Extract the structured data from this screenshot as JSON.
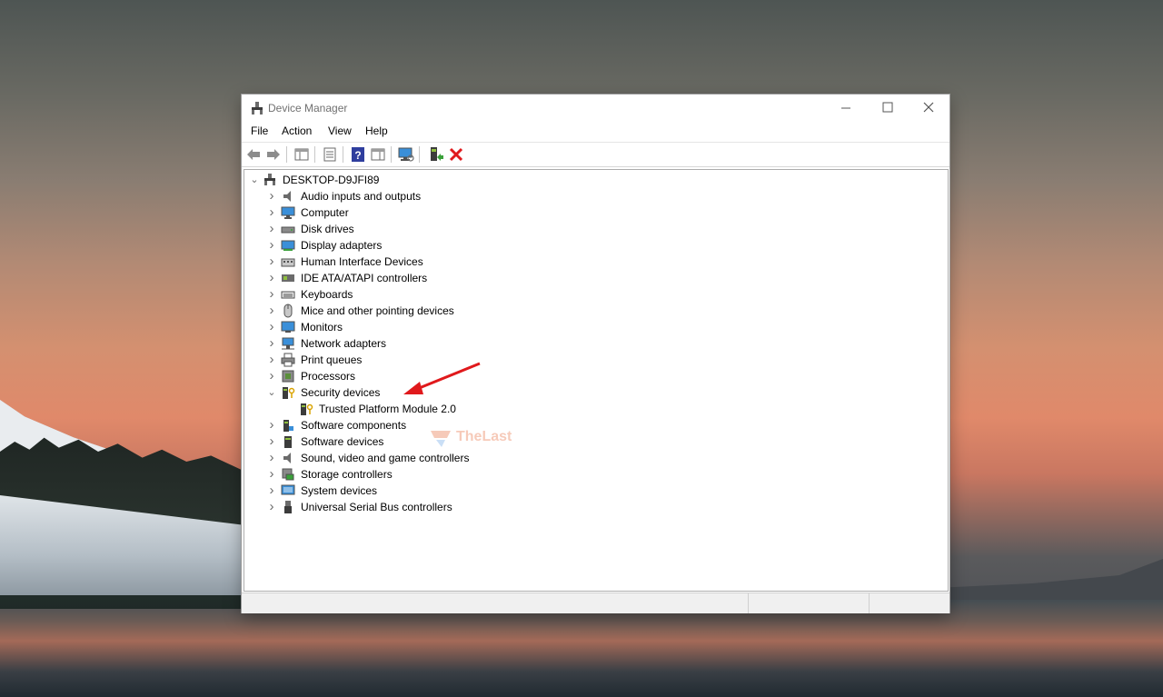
{
  "window": {
    "title": "Device Manager"
  },
  "menu": [
    "File",
    "Action",
    "View",
    "Help"
  ],
  "tree": {
    "root": "DESKTOP-D9JFI89",
    "items": [
      {
        "label": "Audio inputs and outputs",
        "icon": "speaker-icon",
        "expanded": false
      },
      {
        "label": "Computer",
        "icon": "computer-icon",
        "expanded": false
      },
      {
        "label": "Disk drives",
        "icon": "disk-drive-icon",
        "expanded": false
      },
      {
        "label": "Display adapters",
        "icon": "display-adapter-icon",
        "expanded": false
      },
      {
        "label": "Human Interface Devices",
        "icon": "hid-icon",
        "expanded": false
      },
      {
        "label": "IDE ATA/ATAPI controllers",
        "icon": "ide-controller-icon",
        "expanded": false
      },
      {
        "label": "Keyboards",
        "icon": "keyboard-icon",
        "expanded": false
      },
      {
        "label": "Mice and other pointing devices",
        "icon": "mouse-icon",
        "expanded": false
      },
      {
        "label": "Monitors",
        "icon": "monitor-icon",
        "expanded": false
      },
      {
        "label": "Network adapters",
        "icon": "network-adapter-icon",
        "expanded": false
      },
      {
        "label": "Print queues",
        "icon": "printer-icon",
        "expanded": false
      },
      {
        "label": "Processors",
        "icon": "processor-icon",
        "expanded": false
      },
      {
        "label": "Security devices",
        "icon": "security-device-icon",
        "expanded": true
      },
      {
        "label": "Trusted Platform Module 2.0",
        "icon": "tpm-icon",
        "child": true
      },
      {
        "label": "Software components",
        "icon": "software-component-icon",
        "expanded": false
      },
      {
        "label": "Software devices",
        "icon": "software-device-icon",
        "expanded": false
      },
      {
        "label": "Sound, video and game controllers",
        "icon": "sound-controller-icon",
        "expanded": false
      },
      {
        "label": "Storage controllers",
        "icon": "storage-controller-icon",
        "expanded": false
      },
      {
        "label": "System devices",
        "icon": "system-device-icon",
        "expanded": false
      },
      {
        "label": "Universal Serial Bus controllers",
        "icon": "usb-icon",
        "expanded": false
      }
    ]
  },
  "toolbar": [
    "back-arrow-icon",
    "forward-arrow-icon",
    "show-hide-tree-icon",
    "properties-icon",
    "help-icon",
    "action-pane-icon",
    "scan-hardware-icon",
    "update-driver-icon",
    "uninstall-device-icon"
  ],
  "watermark": {
    "text": "TheLast"
  },
  "colors": {
    "accent_red": "#e0191c",
    "window_bg": "#ffffff",
    "status_bg": "#f0f0f0"
  }
}
